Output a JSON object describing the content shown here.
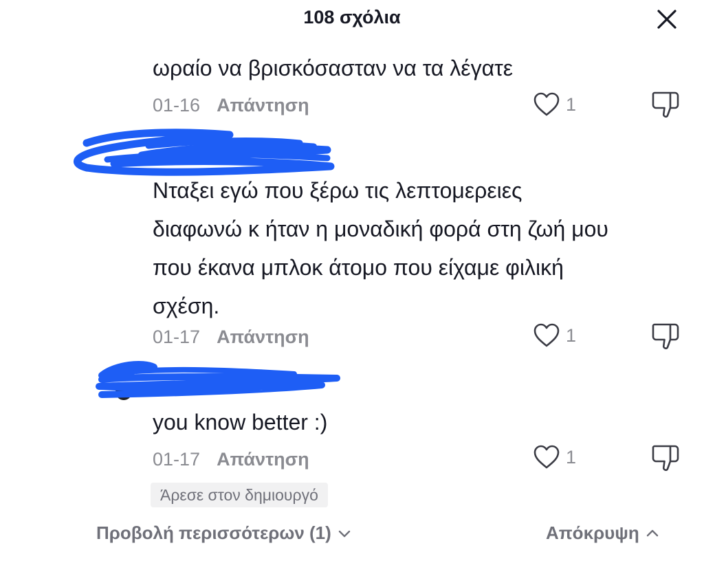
{
  "header": {
    "title": "108 σχόλια"
  },
  "icons": {
    "close": "close-icon",
    "like": "heart-outline-icon",
    "dislike": "thumbs-down-icon",
    "more": "chevron-down-icon",
    "hide": "chevron-up-icon"
  },
  "colors": {
    "text": "#161823",
    "meta": "#8a8b91",
    "redaction": "#1e5ef5",
    "badge_bg": "#f1f1f2"
  },
  "comments": [
    {
      "text": "ωραίο να βρισκόσασταν να τα λέγατε",
      "date": "01-16",
      "reply_label": "Απάντηση",
      "likes": "1"
    },
    {
      "author": "",
      "text": "Νταξει εγώ που ξέρω τις λεπτομερειες\nδιαφωνώ κ ήταν η μοναδική φορά στη ζωή μου\nπου έκανα μπλοκ άτομο που είχαμε φιλική\nσχέση.",
      "date": "01-17",
      "reply_label": "Απάντηση",
      "likes": "1"
    },
    {
      "author": "",
      "text": "you know better :)",
      "date": "01-17",
      "reply_label": "Απάντηση",
      "likes": "1",
      "badge": "Άρεσε στον δημιουργό"
    }
  ],
  "footer": {
    "view_more": "Προβολή περισσότερων (1)",
    "hide": "Απόκρυψη"
  }
}
